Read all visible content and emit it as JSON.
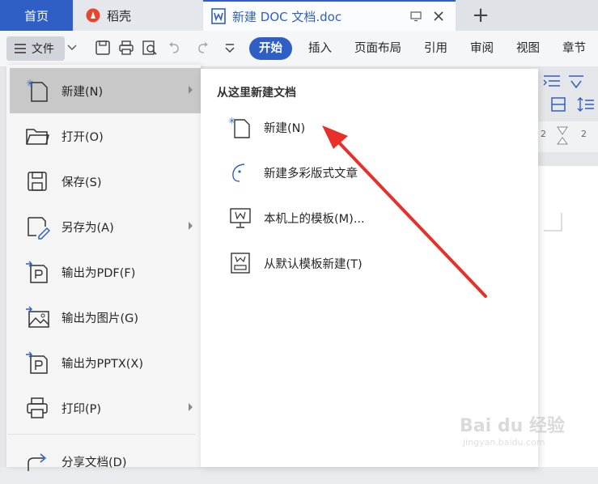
{
  "tabs": {
    "home": "首页",
    "daoke": "稻壳",
    "document": "新建 DOC 文档.doc"
  },
  "toolbar": {
    "file_menu": "文件"
  },
  "ribbon": {
    "tabs": [
      "开始",
      "插入",
      "页面布局",
      "引用",
      "审阅",
      "视图",
      "章节"
    ]
  },
  "file_menu": {
    "items": [
      {
        "label": "新建(N)",
        "icon": "new-doc-icon",
        "has_submenu": true
      },
      {
        "label": "打开(O)",
        "icon": "folder-icon",
        "has_submenu": false
      },
      {
        "label": "保存(S)",
        "icon": "save-icon",
        "has_submenu": false
      },
      {
        "label": "另存为(A)",
        "icon": "save-as-icon",
        "has_submenu": true
      },
      {
        "label": "输出为PDF(F)",
        "icon": "export-pdf-icon",
        "has_submenu": false
      },
      {
        "label": "输出为图片(G)",
        "icon": "export-image-icon",
        "has_submenu": false
      },
      {
        "label": "输出为PPTX(X)",
        "icon": "export-pptx-icon",
        "has_submenu": false
      },
      {
        "label": "打印(P)",
        "icon": "print-icon",
        "has_submenu": true
      },
      {
        "label": "分享文档(D)",
        "icon": "share-icon",
        "has_submenu": false
      }
    ]
  },
  "new_submenu": {
    "title": "从这里新建文档",
    "items": [
      {
        "label": "新建(N)",
        "icon": "new-doc-icon"
      },
      {
        "label": "新建多彩版式文章",
        "icon": "colorful-article-icon"
      },
      {
        "label": "本机上的模板(M)...",
        "icon": "local-template-icon"
      },
      {
        "label": "从默认模板新建(T)",
        "icon": "default-template-icon"
      }
    ]
  },
  "ruler_labels": [
    "2",
    "2"
  ],
  "watermark": {
    "text": "Bai du 经验",
    "sub": "jingyan.baidu.com"
  },
  "colors": {
    "accent": "#2f5fc5",
    "annotation_arrow": "#e8302a"
  }
}
